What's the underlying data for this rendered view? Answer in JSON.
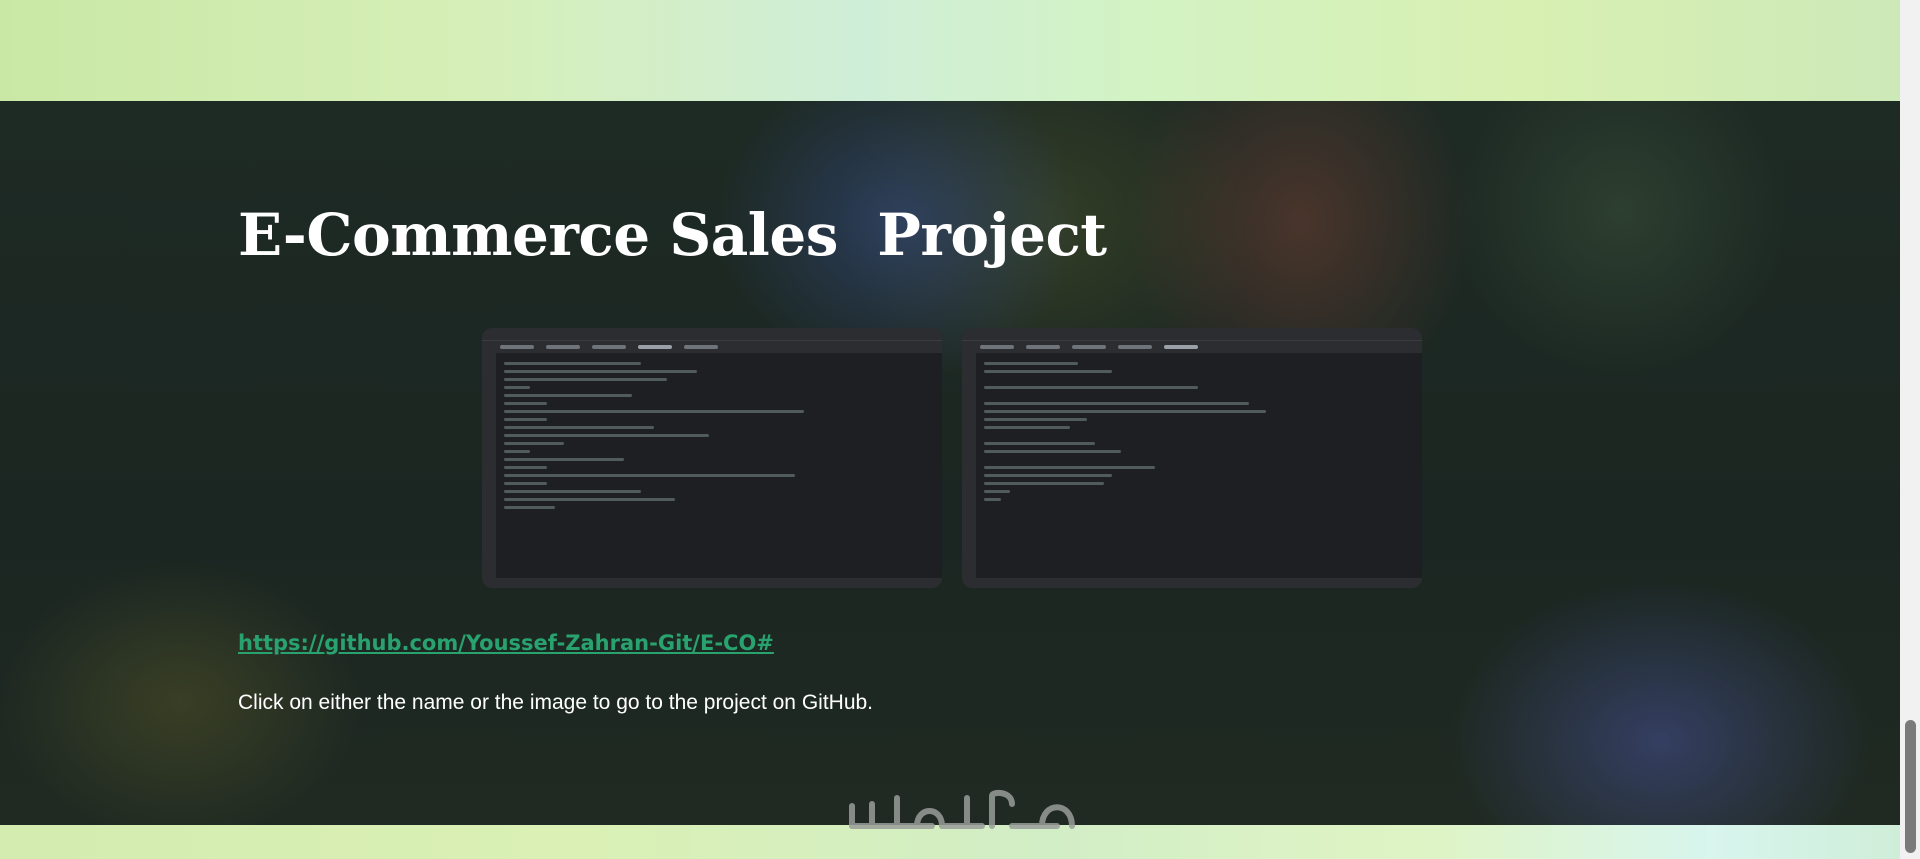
{
  "project": {
    "title": "E-Commerce Sales  Project",
    "link_text": "https://github.com/Youssef-Zahran-Git/E-CO#",
    "note": "Click on either the name or the image to go to the project on GitHub."
  },
  "icons": [
    "ide-screenshot-image",
    "watermark-logo"
  ]
}
